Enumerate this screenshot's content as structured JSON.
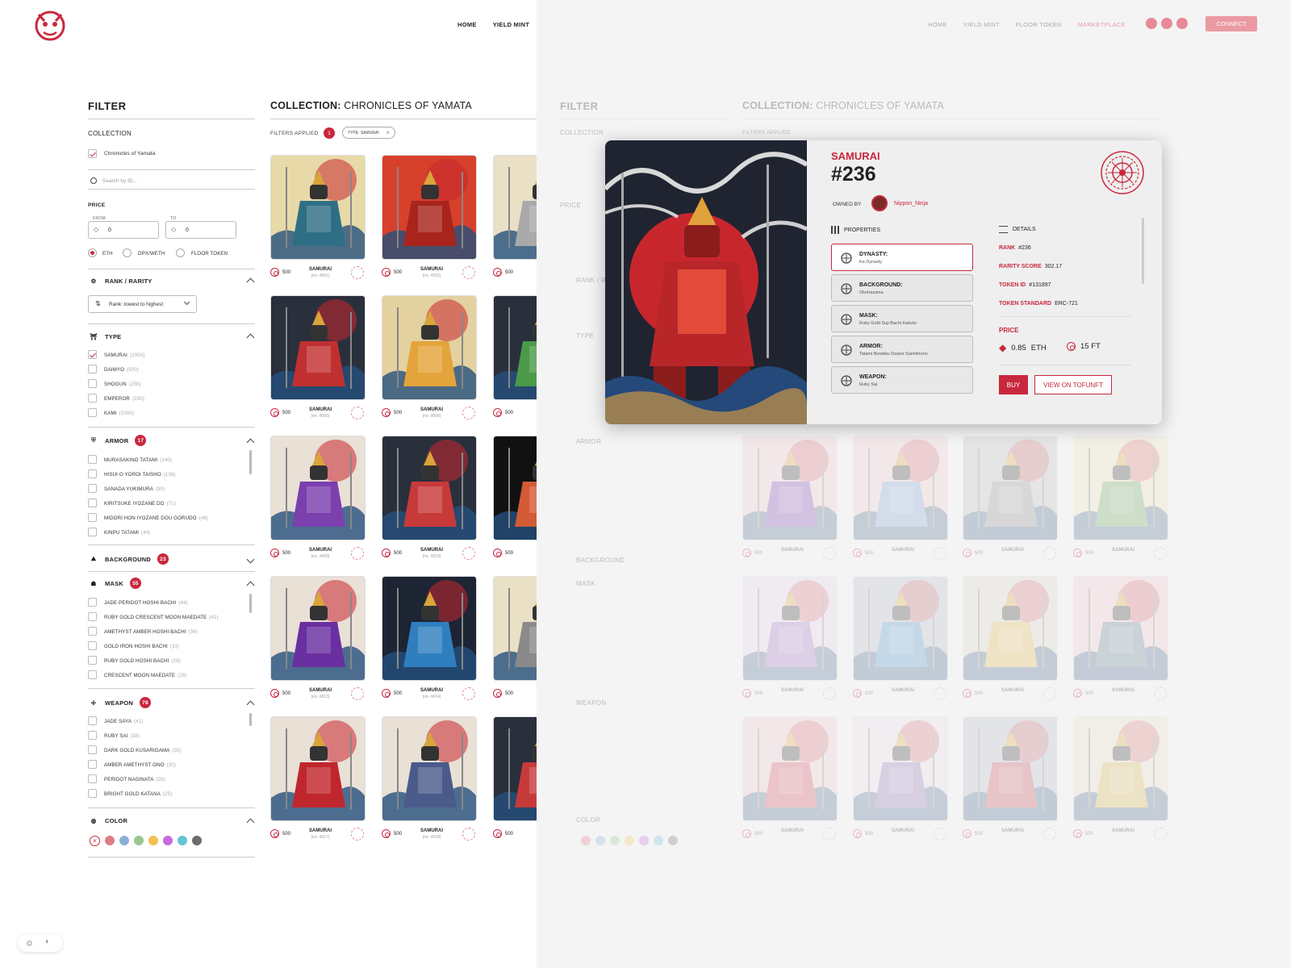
{
  "nav_left": {
    "home": "HOME",
    "yield_mint": "YIELD MINT"
  },
  "nav_right": {
    "home": "HOME",
    "yield_mint": "YIELD MINT",
    "floor_token": "FLOOR TOKEN",
    "marketplace": "MARKETPLACE",
    "connect": "CONNECT"
  },
  "filter": {
    "title": "FILTER",
    "collection_label": "COLLECTION",
    "collection_item": "Chronicles of Yamata",
    "search_placeholder": "Search by ID...",
    "price_label": "PRICE",
    "from_label": "FROM",
    "to_label": "TO",
    "from_value": "0",
    "to_value": "0",
    "currencies": [
      "ETH",
      "DPX/WETH",
      "FLOOR TOKEN"
    ],
    "rank_label": "RANK / RARITY",
    "rank_select": "Rank: lowest to highest",
    "type_label": "TYPE",
    "types": [
      {
        "name": "SAMURAI",
        "count": "(1000)",
        "checked": true
      },
      {
        "name": "DAIMYO",
        "count": "(500)",
        "checked": false
      },
      {
        "name": "SHOGUN",
        "count": "(250)",
        "checked": false
      },
      {
        "name": "EMPEROR",
        "count": "(250)",
        "checked": false
      },
      {
        "name": "KAMI",
        "count": "(1000)",
        "checked": false
      }
    ],
    "armor_label": "ARMOR",
    "armor_count": "17",
    "armors": [
      {
        "name": "MURASAKINO TATAMI",
        "count": "(140)"
      },
      {
        "name": "HISUI O YOROI TAISHO",
        "count": "(138)"
      },
      {
        "name": "SANADA YUKIMURA",
        "count": "(90)"
      },
      {
        "name": "KIRITSUKE IYOZANE DO",
        "count": "(71)"
      },
      {
        "name": "MIDORI HON IYOZANE DOU GORUDO",
        "count": "(46)"
      },
      {
        "name": "KINPU TATAMI",
        "count": "(44)"
      }
    ],
    "background_label": "BACKGROUND",
    "background_count": "23",
    "mask_label": "MASK",
    "mask_count": "55",
    "masks": [
      {
        "name": "JADE PERIDOT HOSHI BACHI",
        "count": "(44)"
      },
      {
        "name": "RUBY GOLD CRESCENT MOON MAEDATE",
        "count": "(41)"
      },
      {
        "name": "AMETHYST AMBER HOSHI BACHI",
        "count": "(36)"
      },
      {
        "name": "GOLD IRON HOSHI BACHI",
        "count": "(33)"
      },
      {
        "name": "RUBY GOLD HOSHI BACHI",
        "count": "(29)"
      },
      {
        "name": "CRESCENT MOON MAEDATE",
        "count": "(28)"
      }
    ],
    "weapon_label": "WEAPON",
    "weapon_count": "78",
    "weapons": [
      {
        "name": "JADE SAYA",
        "count": "(41)"
      },
      {
        "name": "RUBY SAI",
        "count": "(38)"
      },
      {
        "name": "DARK GOLD KUSARIGAMA",
        "count": "(35)"
      },
      {
        "name": "AMBER AMETHYST ONO",
        "count": "(30)"
      },
      {
        "name": "PERIDOT NAGINATA",
        "count": "(28)"
      },
      {
        "name": "BRIGHT GOLD KATANA",
        "count": "(25)"
      }
    ],
    "color_label": "COLOR",
    "colors": [
      "#e07b85",
      "#8ab0d8",
      "#98c78f",
      "#f2c14f",
      "#c86be0",
      "#63c5d6",
      "#6b6b6b"
    ]
  },
  "collection": {
    "title_bold": "COLLECTION:",
    "title_name": "CHRONICLES OF YAMATA",
    "filters_applied_label": "FILTERS APPLIED",
    "filters_applied_count": "1",
    "chip": "TYPE: SAMURAI"
  },
  "cards_left": [
    {
      "price": "500",
      "name": "SAMURAI",
      "no": "(no. #001)",
      "bg": "#e8d9a8",
      "armor": "#2f6f86"
    },
    {
      "price": "500",
      "name": "SAMURAI",
      "no": "(no. #002)",
      "bg": "#d7402b",
      "armor": "#a8241c"
    },
    {
      "price": "500",
      "name": "SAM",
      "no": "(no.",
      "bg": "#e9e0c6",
      "armor": "#a9a9a9"
    },
    {
      "price": "500",
      "name": "SAMURAI",
      "no": "(no. #005)",
      "bg": "#2a2f3c",
      "armor": "#c13030"
    },
    {
      "price": "500",
      "name": "SAMURAI",
      "no": "(no. #006)",
      "bg": "#e3d1a0",
      "armor": "#e3a43b"
    },
    {
      "price": "500",
      "name": "SAM",
      "no": "(no.",
      "bg": "#2a2f3c",
      "armor": "#4b9a48"
    },
    {
      "price": "500",
      "name": "SAMURAI",
      "no": "(no. #009)",
      "bg": "#e9e0d6",
      "armor": "#7b3fae"
    },
    {
      "price": "500",
      "name": "SAMURAI",
      "no": "(no. #010)",
      "bg": "#2a2f3c",
      "armor": "#c73a3a"
    },
    {
      "price": "500",
      "name": "SAM",
      "no": "(no.",
      "bg": "#111111",
      "armor": "#d35b36"
    },
    {
      "price": "500",
      "name": "SAMURAI",
      "no": "(no. #013)",
      "bg": "#e9e0d6",
      "armor": "#6a2fa0"
    },
    {
      "price": "500",
      "name": "SAMURAI",
      "no": "(no. #014)",
      "bg": "#1d2433",
      "armor": "#2f7fbf"
    },
    {
      "price": "500",
      "name": "SAM",
      "no": "(no.",
      "bg": "#e9e0c6",
      "armor": "#8a8a8a"
    },
    {
      "price": "500",
      "name": "SAMURAI",
      "no": "(no. #017)",
      "bg": "#e9e0d6",
      "armor": "#c0262d"
    },
    {
      "price": "500",
      "name": "SAMURAI",
      "no": "(no. #018)",
      "bg": "#e9e0d6",
      "armor": "#4a5a8a"
    },
    {
      "price": "500",
      "name": "SAM",
      "no": "(no.",
      "bg": "#2a2f3c",
      "armor": "#c73a3a"
    }
  ],
  "cards_right": [
    {
      "price": "500",
      "name": "SAMURAI",
      "bg": "#f1c9ce",
      "armor": "#7b3fae"
    },
    {
      "price": "500",
      "name": "SAMURAI",
      "bg": "#f1c9ce",
      "armor": "#7e9fcf"
    },
    {
      "price": "500",
      "name": "SAMURAI",
      "bg": "#bdbdbd",
      "armor": "#8d8d8d"
    },
    {
      "price": "500",
      "name": "SAMURAI",
      "bg": "#eee3bf",
      "armor": "#6aa55a"
    },
    {
      "price": "500",
      "name": "SAMURAI",
      "bg": "#e6d3e8",
      "armor": "#a070c0"
    },
    {
      "price": "500",
      "name": "SAMURAI",
      "bg": "#b6bcc6",
      "armor": "#4c8fc9"
    },
    {
      "price": "500",
      "name": "SAMURAI",
      "bg": "#d9d3c6",
      "armor": "#e1b84e"
    },
    {
      "price": "500",
      "name": "SAMURAI",
      "bg": "#f0c4cb",
      "armor": "#5d7e8c"
    },
    {
      "price": "500",
      "name": "SAMURAI",
      "bg": "#f1c9ce",
      "armor": "#d4485a"
    },
    {
      "price": "500",
      "name": "SAMURAI",
      "bg": "#e8dce6",
      "armor": "#8f6fb2"
    },
    {
      "price": "500",
      "name": "SAMURAI",
      "bg": "#b6bcc6",
      "armor": "#c64a52"
    },
    {
      "price": "500",
      "name": "SAMURAI",
      "bg": "#e8dfc8",
      "armor": "#d8b24a"
    }
  ],
  "modal": {
    "type": "SAMURAI",
    "id": "#236",
    "owned_by_label": "OWNED BY",
    "owner": "Nippon_Ninja",
    "properties_label": "PROPERTIES",
    "details_label": "DETAILS",
    "properties": [
      {
        "key": "DYNASTY:",
        "value": "Ka Dynasty",
        "icon": "fan-icon"
      },
      {
        "key": "BACKGROUND:",
        "value": "Okohazama",
        "icon": "landscape-icon"
      },
      {
        "key": "MASK:",
        "value": "Ruby Gold Suji Bachi Kabuto",
        "icon": "mask-icon"
      },
      {
        "key": "ARMOR:",
        "value": "Tatami Burakku Dopoe Sashimono",
        "icon": "armor-icon"
      },
      {
        "key": "WEAPON:",
        "value": "Ruby Sai",
        "icon": "shuriken-icon"
      }
    ],
    "details": [
      {
        "key": "RANK",
        "value": "#236"
      },
      {
        "key": "RARITY SCORE",
        "value": "302.17"
      },
      {
        "key": "TOKEN ID",
        "value": "#131897"
      },
      {
        "key": "TOKEN STANDARD",
        "value": "ERC-721"
      }
    ],
    "price_label": "PRICE",
    "price_eth": "0.85",
    "price_eth_unit": "ETH",
    "price_ft": "15 FT",
    "buy": "BUY",
    "view": "VIEW ON TOFUNFT"
  }
}
